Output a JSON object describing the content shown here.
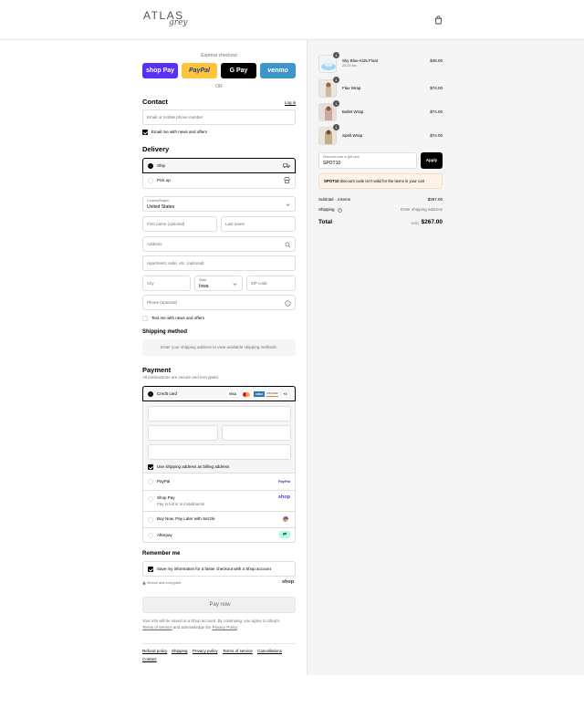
{
  "header": {
    "logo_main": "ATLAS",
    "logo_script": "grey"
  },
  "express": {
    "title": "Express checkout",
    "buttons": [
      {
        "label": "shop Pay",
        "bg": "#5a31f4",
        "fg": "#ffffff"
      },
      {
        "label": "PayPal",
        "bg": "#ffc439",
        "fg": "#253b80"
      },
      {
        "label": "G Pay",
        "bg": "#000000",
        "fg": "#ffffff"
      },
      {
        "label": "venmo",
        "bg": "#3d95ce",
        "fg": "#ffffff"
      }
    ],
    "or": "OR"
  },
  "contact": {
    "title": "Contact",
    "login": "Log in",
    "email_placeholder": "Email or mobile phone number",
    "news_label": "Email me with news and offers",
    "news_checked": true
  },
  "delivery": {
    "title": "Delivery",
    "options": [
      {
        "label": "Ship",
        "selected": true,
        "icon": "truck-icon"
      },
      {
        "label": "Pick up",
        "selected": false,
        "icon": "store-icon"
      }
    ],
    "country_label": "Country/Region",
    "country_value": "United States",
    "first_name": "First name (optional)",
    "last_name": "Last name",
    "address": "Address",
    "apartment": "Apartment, suite, etc. (optional)",
    "city": "City",
    "state_label": "State",
    "state_value": "Iowa",
    "zip": "ZIP code",
    "phone": "Phone (optional)",
    "text_news": "Text me with news and offers"
  },
  "shipping": {
    "title": "Shipping method",
    "message": "Enter your shipping address to view available shipping methods."
  },
  "payment": {
    "title": "Payment",
    "subtitle": "All transactions are secure and encrypted.",
    "credit_card": "Credit card",
    "card_logos": [
      "VISA",
      "MC",
      "AMEX",
      "DISCOVER"
    ],
    "more_cards": "+4",
    "billing_label": "Use shipping address as billing address",
    "methods": [
      {
        "label": "PayPal",
        "sub": "",
        "badge": "PayPal"
      },
      {
        "label": "Shop Pay",
        "sub": "Pay in full or in installments",
        "badge": "shop"
      },
      {
        "label": "Buy Now, Pay Later with Sezzle",
        "sub": "",
        "badge": ""
      },
      {
        "label": "Afterpay",
        "sub": "",
        "badge": ""
      }
    ]
  },
  "remember": {
    "title": "Remember me",
    "save_label": "Save my information for a faster checkout with a Shop account",
    "secure": "Secure and encrypted",
    "shop": "shop"
  },
  "pay_now": "Pay now",
  "legal": {
    "line1": "Your info will be saved to a Shop account. By continuing, you agree to Shop's",
    "tos": "Terms of Service",
    "and": " and acknowledge the ",
    "privacy": "Privacy Policy",
    "end": "."
  },
  "footer_links": [
    "Refund policy",
    "Shipping",
    "Privacy policy",
    "Terms of service",
    "Cancellations",
    "Contact"
  ],
  "summary": {
    "items": [
      {
        "name": "Sky Blue Kids Float",
        "sub": "20-50 lbs",
        "price": "$45.00",
        "qty": "1"
      },
      {
        "name": "Flax Wrap",
        "sub": "",
        "price": "$74.00",
        "qty": "1"
      },
      {
        "name": "Ballet Wrap",
        "sub": "",
        "price": "$74.00",
        "qty": "1"
      },
      {
        "name": "Spelt Wrap",
        "sub": "",
        "price": "$74.00",
        "qty": "1"
      }
    ],
    "discount_label": "Discount code or gift card",
    "discount_value": "SPOT10",
    "apply": "Apply",
    "error_code": "SPOT10",
    "error_msg": " discount code isn't valid for the items in your cart",
    "subtotal_label": "Subtotal · 4 items",
    "subtotal_value": "$267.00",
    "shipping_label": "Shipping",
    "shipping_value": "Enter shipping address",
    "total_label": "Total",
    "currency": "USD",
    "total_value": "$267.00"
  }
}
